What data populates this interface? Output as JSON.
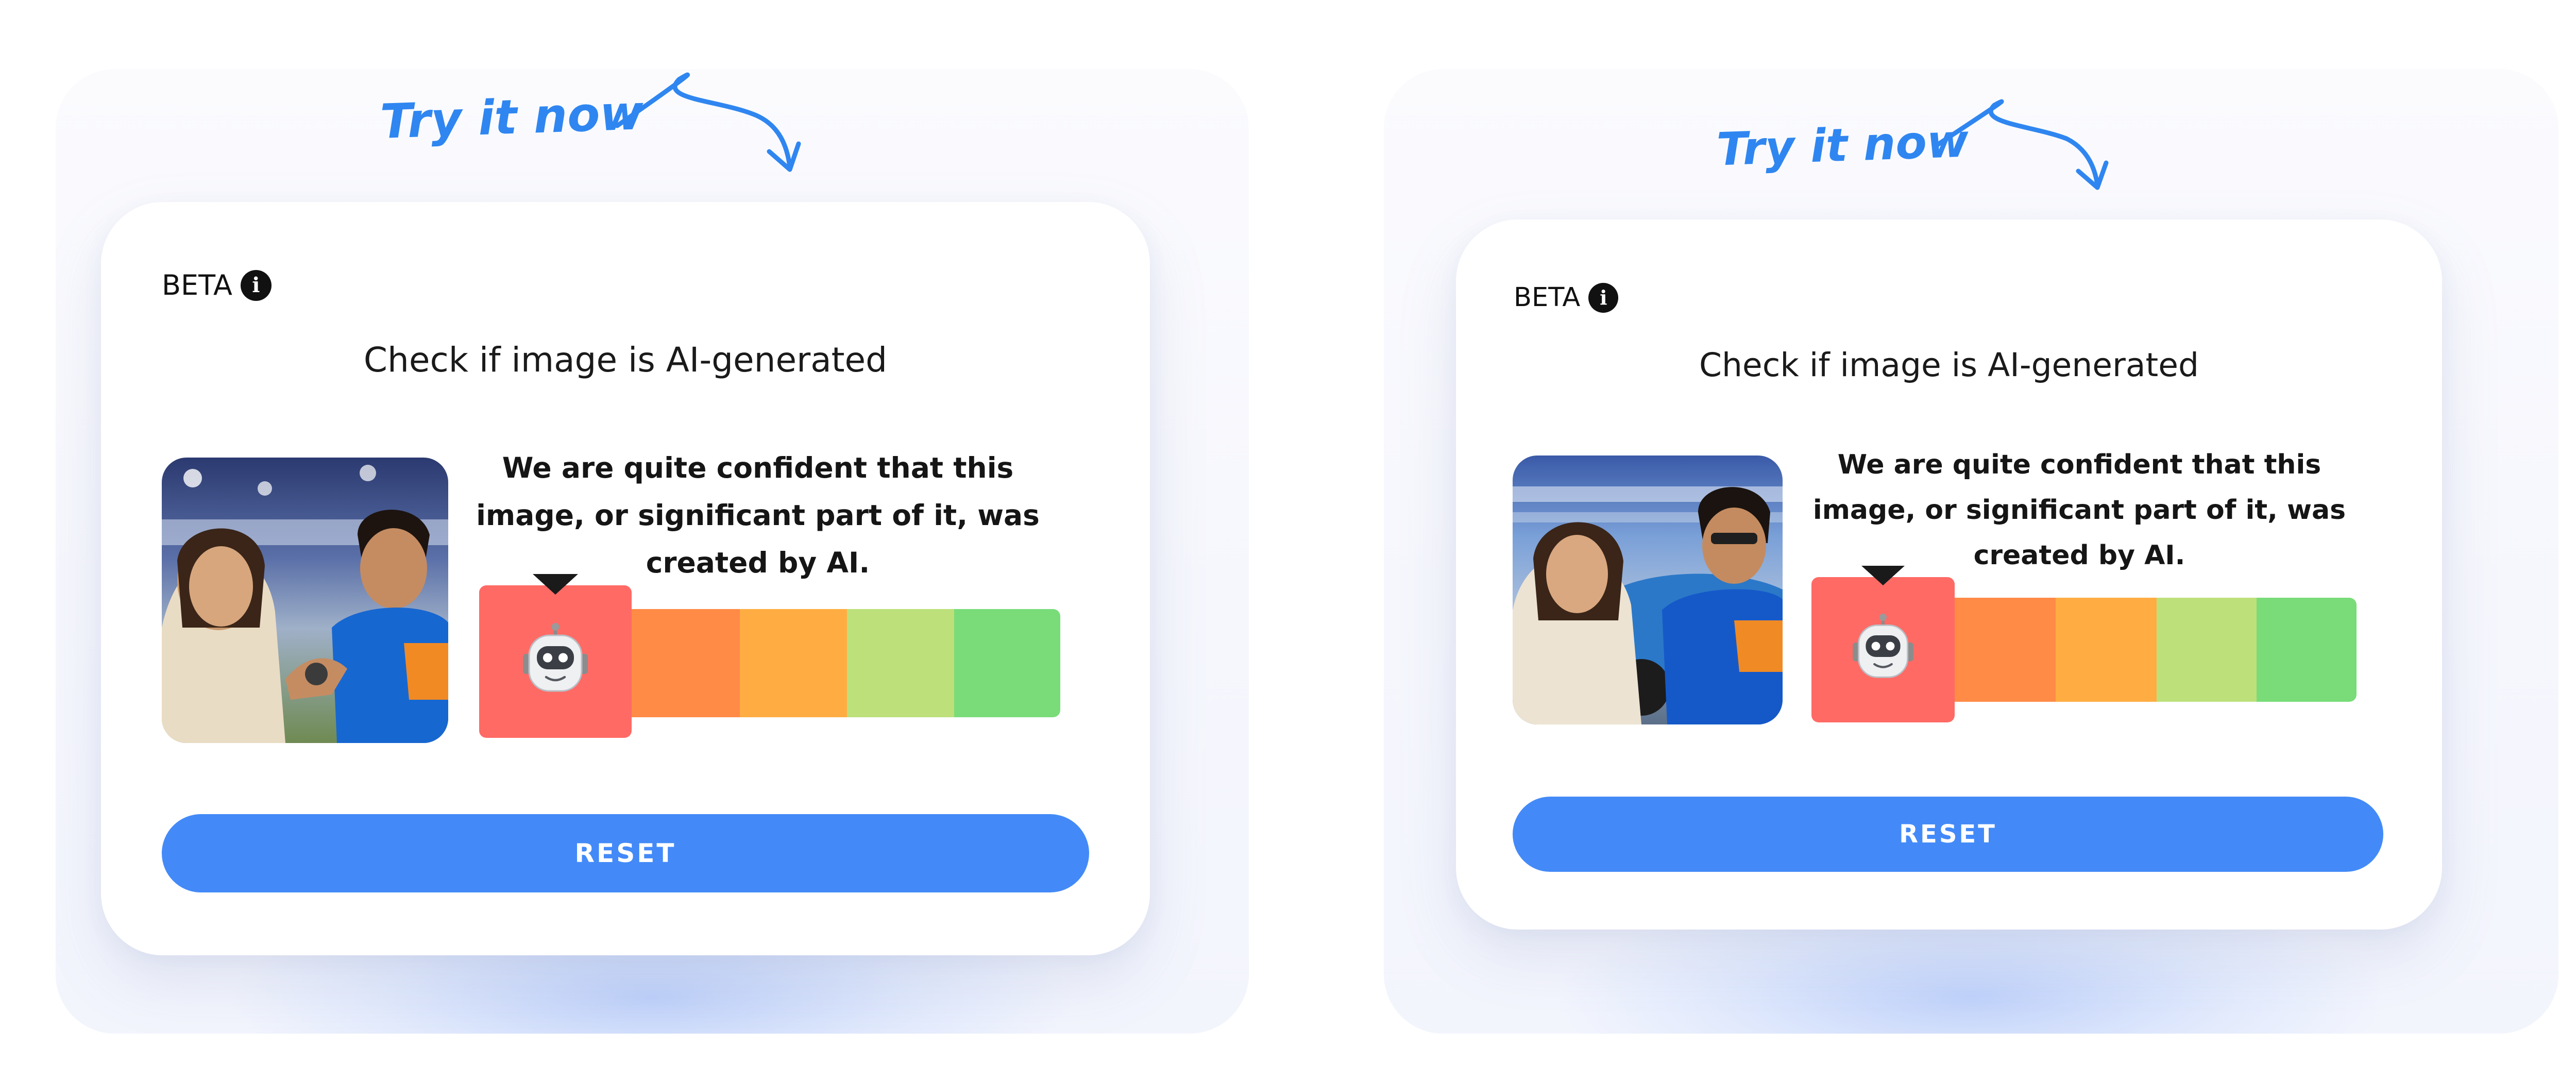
{
  "widgets": [
    {
      "callout": "Try it now",
      "beta_label": "BETA",
      "title": "Check if image is AI-generated",
      "verdict": "We are quite confident that this image, or significant part of it, was created by AI.",
      "reset_label": "RESET",
      "meter_level": "1 of 5 (most likely AI)"
    },
    {
      "callout": "Try it now",
      "beta_label": "BETA",
      "title": "Check if image is AI-generated",
      "verdict": "We are quite confident that this image, or significant part of it, was created by AI.",
      "reset_label": "RESET",
      "meter_level": "1 of 5 (most likely AI)"
    }
  ],
  "colors": {
    "accent_blue": "#438af8",
    "callout_blue": "#2f86f0",
    "meter_active": "#ff6a65",
    "meter_scale": [
      "#ff6a65",
      "#ff8b47",
      "#ffad42",
      "#bde07b",
      "#79dc79"
    ]
  },
  "icons": [
    "info-icon",
    "robot-icon",
    "curved-arrow-icon"
  ]
}
